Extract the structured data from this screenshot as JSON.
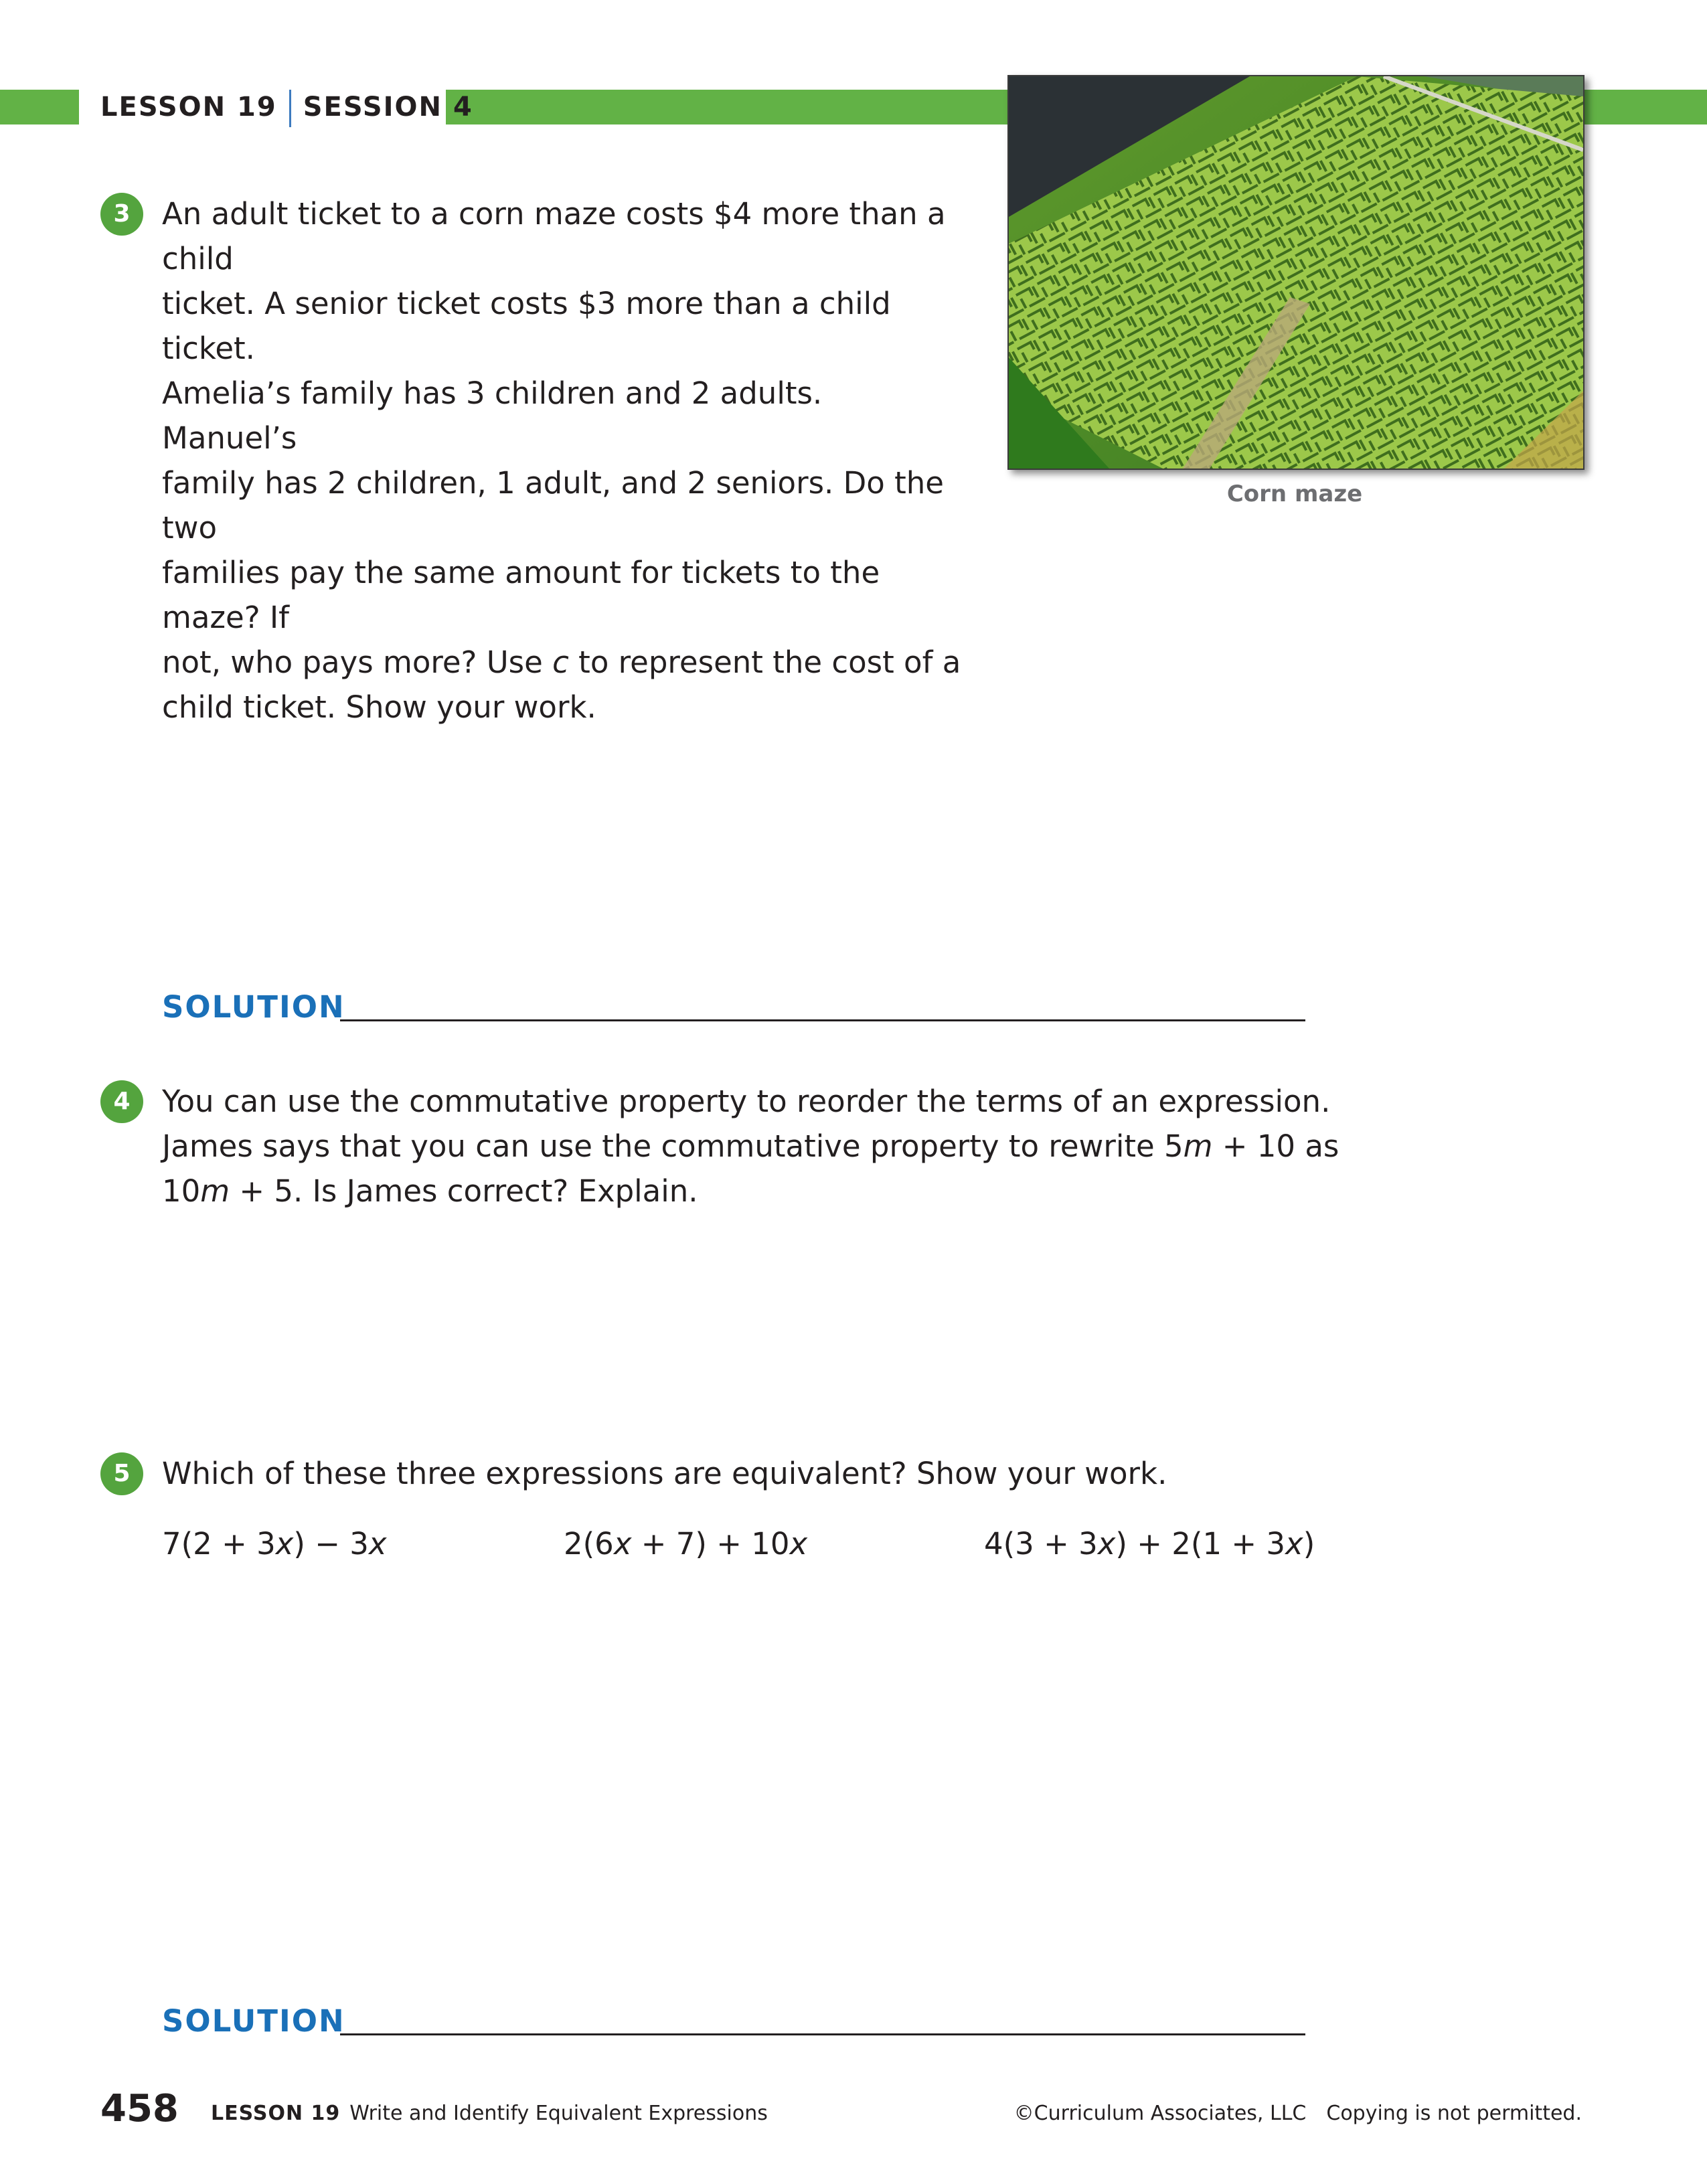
{
  "header": {
    "lesson": "LESSON 19",
    "session": "SESSION 4"
  },
  "colors": {
    "accent_green": "#62b246",
    "solution_blue": "#1a70b8",
    "number_circle": "#54a43e"
  },
  "image": {
    "caption": "Corn maze"
  },
  "problems": [
    {
      "number": "3",
      "lines": [
        "An adult ticket to a corn maze costs $4 more than a child",
        "ticket. A senior ticket costs $3 more than a child ticket.",
        "Amelia’s family has 3 children and 2 adults. Manuel’s",
        "family has 2 children, 1 adult, and 2 seniors. Do the two",
        "families pay the same amount for tickets to the maze? If",
        "not, who pays more? Use ",
        "c",
        " to represent the cost of a",
        "child ticket. Show your work."
      ],
      "solution_label": "SOLUTION"
    },
    {
      "number": "4",
      "line1": "You can use the commutative property to reorder the terms of an expression.",
      "line2_a": "James says that you can use the commutative property to rewrite 5",
      "line2_b": "m",
      "line2_c": " + 10 as",
      "line3_a": "10",
      "line3_b": "m",
      "line3_c": " + 5. Is James correct? Explain."
    },
    {
      "number": "5",
      "prompt": "Which of these three expressions are equivalent? Show your work.",
      "expressions": [
        [
          "7(2 + 3",
          "x",
          ") − 3",
          "x"
        ],
        [
          "2(6",
          "x",
          " + 7) + 10",
          "x"
        ],
        [
          "4(3 + 3",
          "x",
          ") + 2(1 + 3",
          "x",
          ")"
        ]
      ],
      "solution_label": "SOLUTION"
    }
  ],
  "footer": {
    "page_number": "458",
    "lesson": "LESSON 19",
    "lesson_title": "Write and Identify Equivalent Expressions",
    "copyright": "©Curriculum Associates, LLC",
    "notice": "Copying is not permitted."
  }
}
